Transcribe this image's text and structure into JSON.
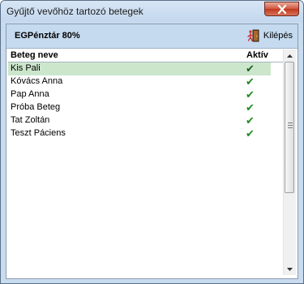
{
  "window": {
    "title": "Gyűjtő vevőhöz tartozó betegek"
  },
  "header": {
    "fund_label": "EGPénztár 80%",
    "exit_label": "Kilépés"
  },
  "table": {
    "columns": {
      "name": "Beteg neve",
      "active": "Aktív"
    },
    "rows": [
      {
        "name": "Kis Pali",
        "active": "✔"
      },
      {
        "name": "Kóvács Anna",
        "active": "✔"
      },
      {
        "name": "Pap Anna",
        "active": "✔"
      },
      {
        "name": "Próba Beteg",
        "active": "✔"
      },
      {
        "name": "Tat Zoltán",
        "active": "✔"
      },
      {
        "name": "Teszt Páciens",
        "active": "✔"
      }
    ],
    "selected_row": 0
  },
  "icons": {
    "close": "close-icon",
    "exit": "exit-door-icon",
    "check": "checkmark-icon",
    "scroll_up": "arrow-up-icon",
    "scroll_down": "arrow-down-icon"
  },
  "colors": {
    "selected_row": "#cce6cc",
    "check": "#1e8a1e",
    "header_bar": "#c5daef",
    "close_button": "#c0391f"
  }
}
